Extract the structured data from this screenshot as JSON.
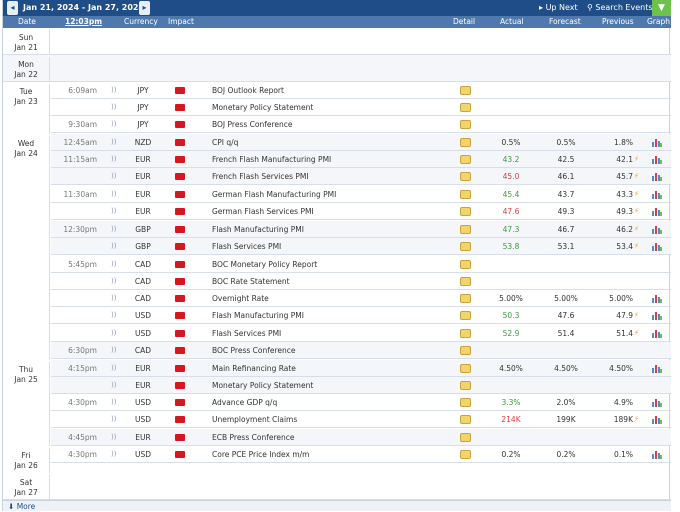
{
  "toolbar": {
    "prev_icon": "◂",
    "range": "Jan 21, 2024 - Jan 27, 2024",
    "next_icon": "▸",
    "up_next": "Up Next",
    "search": "Search Events",
    "filter_icon": "▼"
  },
  "header": {
    "date": "Date",
    "time": "12:03pm",
    "currency": "Currency",
    "impact": "Impact",
    "detail": "Detail",
    "actual": "Actual",
    "forecast": "Forecast",
    "previous": "Previous",
    "graph": "Graph"
  },
  "days": [
    {
      "weekday": "Sun",
      "date": "Jan 21"
    },
    {
      "weekday": "Mon",
      "date": "Jan 22"
    },
    {
      "weekday": "Tue",
      "date": "Jan 23"
    },
    {
      "weekday": "Wed",
      "date": "Jan 24"
    },
    {
      "weekday": "Thu",
      "date": "Jan 25"
    },
    {
      "weekday": "Fri",
      "date": "Jan 26"
    },
    {
      "weekday": "Sat",
      "date": "Jan 27"
    }
  ],
  "events": [
    {
      "time": "6:09am",
      "currency": "JPY",
      "event": "BOJ Outlook Report",
      "actual": "",
      "forecast": "",
      "previous": ""
    },
    {
      "time": "",
      "currency": "JPY",
      "event": "Monetary Policy Statement",
      "actual": "",
      "forecast": "",
      "previous": ""
    },
    {
      "time": "9:30am",
      "currency": "JPY",
      "event": "BOJ Press Conference",
      "actual": "",
      "forecast": "",
      "previous": ""
    },
    {
      "time": "12:45am",
      "currency": "NZD",
      "event": "CPI q/q",
      "actual": "0.5%",
      "forecast": "0.5%",
      "previous": "1.8%"
    },
    {
      "time": "11:15am",
      "currency": "EUR",
      "event": "French Flash Manufacturing PMI",
      "actual": "43.2",
      "forecast": "42.5",
      "previous": "42.1"
    },
    {
      "time": "",
      "currency": "EUR",
      "event": "French Flash Services PMI",
      "actual": "45.0",
      "forecast": "46.1",
      "previous": "45.7"
    },
    {
      "time": "11:30am",
      "currency": "EUR",
      "event": "German Flash Manufacturing PMI",
      "actual": "45.4",
      "forecast": "43.7",
      "previous": "43.3"
    },
    {
      "time": "",
      "currency": "EUR",
      "event": "German Flash Services PMI",
      "actual": "47.6",
      "forecast": "49.3",
      "previous": "49.3"
    },
    {
      "time": "12:30pm",
      "currency": "GBP",
      "event": "Flash Manufacturing PMI",
      "actual": "47.3",
      "forecast": "46.7",
      "previous": "46.2"
    },
    {
      "time": "",
      "currency": "GBP",
      "event": "Flash Services PMI",
      "actual": "53.8",
      "forecast": "53.1",
      "previous": "53.4"
    },
    {
      "time": "5:45pm",
      "currency": "CAD",
      "event": "BOC Monetary Policy Report",
      "actual": "",
      "forecast": "",
      "previous": ""
    },
    {
      "time": "",
      "currency": "CAD",
      "event": "BOC Rate Statement",
      "actual": "",
      "forecast": "",
      "previous": ""
    },
    {
      "time": "",
      "currency": "CAD",
      "event": "Overnight Rate",
      "actual": "5.00%",
      "forecast": "5.00%",
      "previous": "5.00%"
    },
    {
      "time": "",
      "currency": "USD",
      "event": "Flash Manufacturing PMI",
      "actual": "50.3",
      "forecast": "47.6",
      "previous": "47.9"
    },
    {
      "time": "",
      "currency": "USD",
      "event": "Flash Services PMI",
      "actual": "52.9",
      "forecast": "51.4",
      "previous": "51.4"
    },
    {
      "time": "6:30pm",
      "currency": "CAD",
      "event": "BOC Press Conference",
      "actual": "",
      "forecast": "",
      "previous": ""
    },
    {
      "time": "4:15pm",
      "currency": "EUR",
      "event": "Main Refinancing Rate",
      "actual": "4.50%",
      "forecast": "4.50%",
      "previous": "4.50%"
    },
    {
      "time": "",
      "currency": "EUR",
      "event": "Monetary Policy Statement",
      "actual": "",
      "forecast": "",
      "previous": ""
    },
    {
      "time": "4:30pm",
      "currency": "USD",
      "event": "Advance GDP q/q",
      "actual": "3.3%",
      "forecast": "2.0%",
      "previous": "4.9%"
    },
    {
      "time": "",
      "currency": "USD",
      "event": "Unemployment Claims",
      "actual": "214K",
      "forecast": "199K",
      "previous": "189K"
    },
    {
      "time": "4:45pm",
      "currency": "EUR",
      "event": "ECB Press Conference",
      "actual": "",
      "forecast": "",
      "previous": ""
    },
    {
      "time": "4:30pm",
      "currency": "USD",
      "event": "Core PCE Price Index m/m",
      "actual": "0.2%",
      "forecast": "0.2%",
      "previous": "0.1%"
    }
  ],
  "icons": {
    "sound": "sound-icon",
    "impact": "high-impact-icon",
    "detail": "detail-folder-icon",
    "graph": "bar-graph-icon",
    "revised": "revised-flag-icon"
  },
  "colors": {
    "topbar": "#1f4d87",
    "header": "#4f79ad",
    "impact_high": "#d7161f",
    "better": "#3c9a3c",
    "worse": "#d64040",
    "revised": "#e6a11c"
  },
  "more": "More"
}
